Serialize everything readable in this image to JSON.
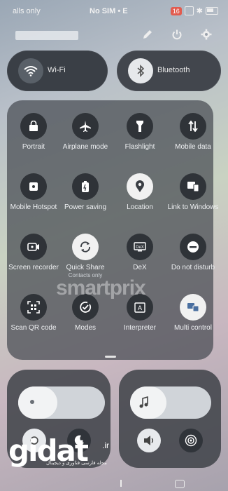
{
  "status_bar": {
    "left_text": "alls only",
    "center_text": "No SIM • E",
    "battery_badge": "16"
  },
  "quick_toggles": {
    "wifi": {
      "label": "Wi-Fi",
      "icon": "wifi-icon"
    },
    "bluetooth": {
      "label": "Bluetooth",
      "icon": "bluetooth-icon"
    }
  },
  "tiles": [
    {
      "label": "Portrait",
      "icon": "portrait-lock-icon",
      "on": false
    },
    {
      "label": "Airplane mode",
      "icon": "airplane-icon",
      "on": false
    },
    {
      "label": "Flashlight",
      "icon": "flashlight-icon",
      "on": false
    },
    {
      "label": "Mobile data",
      "icon": "mobile-data-icon",
      "on": false
    },
    {
      "label": "Mobile Hotspot",
      "icon": "hotspot-icon",
      "on": false
    },
    {
      "label": "Power saving",
      "icon": "power-saving-icon",
      "on": false
    },
    {
      "label": "Location",
      "icon": "location-icon",
      "on": true
    },
    {
      "label": "Link to Windows",
      "icon": "link-windows-icon",
      "on": false
    },
    {
      "label": "Screen recorder",
      "icon": "screen-recorder-icon",
      "on": false
    },
    {
      "label": "Quick Share",
      "sublabel": "Contacts only",
      "icon": "quick-share-icon",
      "on": true
    },
    {
      "label": "DeX",
      "icon": "dex-icon",
      "on": false
    },
    {
      "label": "Do not disturb",
      "icon": "do-not-disturb-icon",
      "on": false
    },
    {
      "label": "Scan QR code",
      "icon": "qr-scan-icon",
      "on": false
    },
    {
      "label": "Modes",
      "icon": "modes-icon",
      "on": false
    },
    {
      "label": "Interpreter",
      "icon": "interpreter-icon",
      "on": false
    },
    {
      "label": "Multi control",
      "icon": "multi-control-icon",
      "on": true
    }
  ],
  "watermark": "smartprix",
  "branding": {
    "logo": "gidat",
    "tld": ".ir",
    "tagline": "مجله فارسی فناوری و دیجیتال"
  },
  "colors": {
    "tile_off": "#2f3338",
    "tile_on": "#f1f1f1",
    "panel": "#3e4248"
  }
}
